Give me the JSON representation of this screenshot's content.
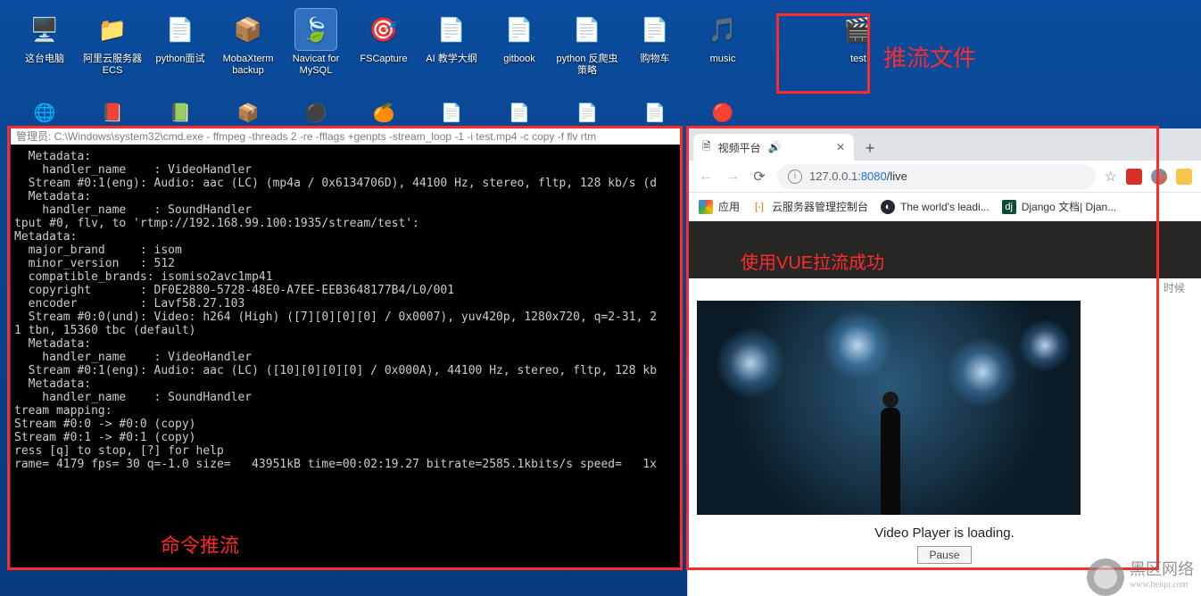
{
  "desktop_icons_row1": [
    {
      "label": "这台电脑",
      "icon": "🖥️",
      "color": "#4aa8e8"
    },
    {
      "label": "阿里云服务器 ECS",
      "icon": "📁",
      "color": "#f6c549"
    },
    {
      "label": "python面试",
      "icon": "📄",
      "color": "#e8e8e8"
    },
    {
      "label": "MobaXterm backup",
      "icon": "📦",
      "color": "#d69a4a"
    },
    {
      "label": "Navicat for MySQL",
      "icon": "🍃",
      "color": "#3ab54a",
      "selected": true
    },
    {
      "label": "FSCapture",
      "icon": "🎯",
      "color": "#e85a2a"
    },
    {
      "label": "AI 教学大纲",
      "icon": "📄",
      "color": "#e8e8e8"
    },
    {
      "label": "gitbook",
      "icon": "📄",
      "color": "#e8e8e8"
    },
    {
      "label": "python 反爬虫策略",
      "icon": "📄",
      "color": "#e8e8e8"
    },
    {
      "label": "购物车",
      "icon": "📄",
      "color": "#e8e8e8"
    },
    {
      "label": "music",
      "icon": "🎵",
      "color": "#e8322a"
    },
    {
      "label": "",
      "icon": "",
      "color": "transparent"
    },
    {
      "label": "test",
      "icon": "🎬",
      "color": "#2a7ae8"
    }
  ],
  "desktop_icons_row2": [
    {
      "icon": "🌐",
      "color": "#3a6aa8"
    },
    {
      "icon": "📕",
      "color": "#e8322a"
    },
    {
      "icon": "📗",
      "color": "#3ab54a"
    },
    {
      "icon": "📦",
      "color": "#d69a4a"
    },
    {
      "icon": "⚫",
      "color": "#2a2a2a"
    },
    {
      "icon": "🍊",
      "color": "#e8882a"
    },
    {
      "icon": "📄",
      "color": "#e8e8e8"
    },
    {
      "icon": "📄",
      "color": "#e8e8e8"
    },
    {
      "icon": "📄",
      "color": "#e8e8e8"
    },
    {
      "icon": "📄",
      "color": "#e8e8e8"
    },
    {
      "icon": "🔴",
      "color": "#e8322a"
    }
  ],
  "annotations": {
    "file_label": "推流文件",
    "cmd_label": "命令推流",
    "vue_label": "使用VUE拉流成功"
  },
  "terminal": {
    "title": "管理员: C:\\Windows\\system32\\cmd.exe - ffmpeg  -threads 2 -re -fflags +genpts -stream_loop -1 -i test.mp4 -c copy -f flv rtm",
    "lines": [
      "  Metadata:",
      "    handler_name    : VideoHandler",
      "  Stream #0:1(eng): Audio: aac (LC) (mp4a / 0x6134706D), 44100 Hz, stereo, fltp, 128 kb/s (d",
      "  Metadata:",
      "    handler_name    : SoundHandler",
      "tput #0, flv, to 'rtmp://192.168.99.100:1935/stream/test':",
      "Metadata:",
      "  major_brand     : isom",
      "  minor_version   : 512",
      "  compatible_brands: isomiso2avc1mp41",
      "  copyright       : DF0E2880-5728-48E0-A7EE-EEB3648177B4/L0/001",
      "  encoder         : Lavf58.27.103",
      "  Stream #0:0(und): Video: h264 (High) ([7][0][0][0] / 0x0007), yuv420p, 1280x720, q=2-31, 2",
      "1 tbn, 15360 tbc (default)",
      "  Metadata:",
      "    handler_name    : VideoHandler",
      "  Stream #0:1(eng): Audio: aac (LC) ([10][0][0][0] / 0x000A), 44100 Hz, stereo, fltp, 128 kb",
      "  Metadata:",
      "    handler_name    : SoundHandler",
      "tream mapping:",
      "Stream #0:0 -> #0:0 (copy)",
      "Stream #0:1 -> #0:1 (copy)",
      "ress [q] to stop, [?] for help",
      "rame= 4179 fps= 30 q=-1.0 size=   43951kB time=00:02:19.27 bitrate=2585.1kbits/s speed=   1x"
    ]
  },
  "browser": {
    "tab_title": "视频平台",
    "url_host": "127.0.0.1:",
    "url_port": "8080",
    "url_path": "/live",
    "bookmarks": {
      "apps": "应用",
      "aliyun": "云服务器管理控制台",
      "github": "The world's leadi...",
      "django": "Django 文档| Djan..."
    },
    "page": {
      "top_text": "时候",
      "loading": "Video Player is loading.",
      "pause": "Pause"
    }
  },
  "watermark": {
    "title": "黑区网络",
    "url": "www.heiqu.com"
  }
}
